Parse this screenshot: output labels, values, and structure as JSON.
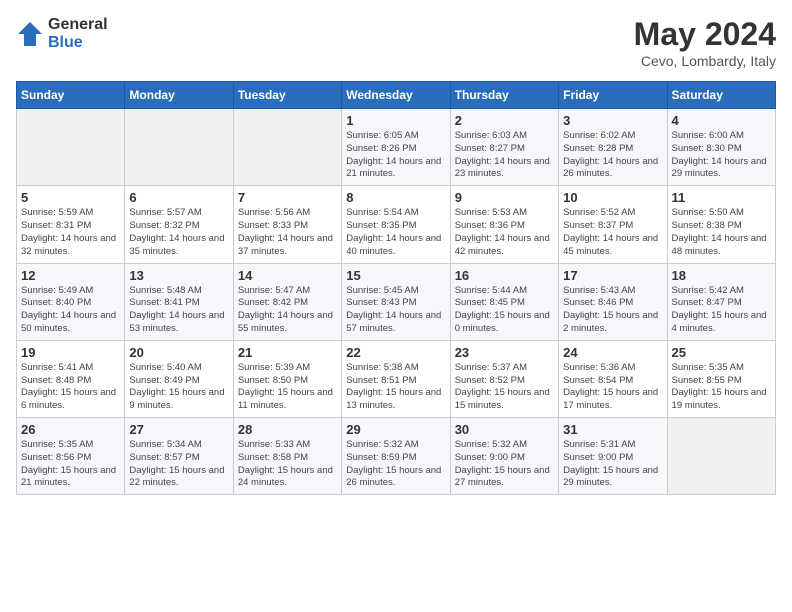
{
  "logo": {
    "general": "General",
    "blue": "Blue"
  },
  "header": {
    "title": "May 2024",
    "subtitle": "Cevo, Lombardy, Italy"
  },
  "weekdays": [
    "Sunday",
    "Monday",
    "Tuesday",
    "Wednesday",
    "Thursday",
    "Friday",
    "Saturday"
  ],
  "weeks": [
    [
      {
        "day": null
      },
      {
        "day": null
      },
      {
        "day": null
      },
      {
        "day": 1,
        "sunrise": "Sunrise: 6:05 AM",
        "sunset": "Sunset: 8:26 PM",
        "daylight": "Daylight: 14 hours and 21 minutes."
      },
      {
        "day": 2,
        "sunrise": "Sunrise: 6:03 AM",
        "sunset": "Sunset: 8:27 PM",
        "daylight": "Daylight: 14 hours and 23 minutes."
      },
      {
        "day": 3,
        "sunrise": "Sunrise: 6:02 AM",
        "sunset": "Sunset: 8:28 PM",
        "daylight": "Daylight: 14 hours and 26 minutes."
      },
      {
        "day": 4,
        "sunrise": "Sunrise: 6:00 AM",
        "sunset": "Sunset: 8:30 PM",
        "daylight": "Daylight: 14 hours and 29 minutes."
      }
    ],
    [
      {
        "day": 5,
        "sunrise": "Sunrise: 5:59 AM",
        "sunset": "Sunset: 8:31 PM",
        "daylight": "Daylight: 14 hours and 32 minutes."
      },
      {
        "day": 6,
        "sunrise": "Sunrise: 5:57 AM",
        "sunset": "Sunset: 8:32 PM",
        "daylight": "Daylight: 14 hours and 35 minutes."
      },
      {
        "day": 7,
        "sunrise": "Sunrise: 5:56 AM",
        "sunset": "Sunset: 8:33 PM",
        "daylight": "Daylight: 14 hours and 37 minutes."
      },
      {
        "day": 8,
        "sunrise": "Sunrise: 5:54 AM",
        "sunset": "Sunset: 8:35 PM",
        "daylight": "Daylight: 14 hours and 40 minutes."
      },
      {
        "day": 9,
        "sunrise": "Sunrise: 5:53 AM",
        "sunset": "Sunset: 8:36 PM",
        "daylight": "Daylight: 14 hours and 42 minutes."
      },
      {
        "day": 10,
        "sunrise": "Sunrise: 5:52 AM",
        "sunset": "Sunset: 8:37 PM",
        "daylight": "Daylight: 14 hours and 45 minutes."
      },
      {
        "day": 11,
        "sunrise": "Sunrise: 5:50 AM",
        "sunset": "Sunset: 8:38 PM",
        "daylight": "Daylight: 14 hours and 48 minutes."
      }
    ],
    [
      {
        "day": 12,
        "sunrise": "Sunrise: 5:49 AM",
        "sunset": "Sunset: 8:40 PM",
        "daylight": "Daylight: 14 hours and 50 minutes."
      },
      {
        "day": 13,
        "sunrise": "Sunrise: 5:48 AM",
        "sunset": "Sunset: 8:41 PM",
        "daylight": "Daylight: 14 hours and 53 minutes."
      },
      {
        "day": 14,
        "sunrise": "Sunrise: 5:47 AM",
        "sunset": "Sunset: 8:42 PM",
        "daylight": "Daylight: 14 hours and 55 minutes."
      },
      {
        "day": 15,
        "sunrise": "Sunrise: 5:45 AM",
        "sunset": "Sunset: 8:43 PM",
        "daylight": "Daylight: 14 hours and 57 minutes."
      },
      {
        "day": 16,
        "sunrise": "Sunrise: 5:44 AM",
        "sunset": "Sunset: 8:45 PM",
        "daylight": "Daylight: 15 hours and 0 minutes."
      },
      {
        "day": 17,
        "sunrise": "Sunrise: 5:43 AM",
        "sunset": "Sunset: 8:46 PM",
        "daylight": "Daylight: 15 hours and 2 minutes."
      },
      {
        "day": 18,
        "sunrise": "Sunrise: 5:42 AM",
        "sunset": "Sunset: 8:47 PM",
        "daylight": "Daylight: 15 hours and 4 minutes."
      }
    ],
    [
      {
        "day": 19,
        "sunrise": "Sunrise: 5:41 AM",
        "sunset": "Sunset: 8:48 PM",
        "daylight": "Daylight: 15 hours and 6 minutes."
      },
      {
        "day": 20,
        "sunrise": "Sunrise: 5:40 AM",
        "sunset": "Sunset: 8:49 PM",
        "daylight": "Daylight: 15 hours and 9 minutes."
      },
      {
        "day": 21,
        "sunrise": "Sunrise: 5:39 AM",
        "sunset": "Sunset: 8:50 PM",
        "daylight": "Daylight: 15 hours and 11 minutes."
      },
      {
        "day": 22,
        "sunrise": "Sunrise: 5:38 AM",
        "sunset": "Sunset: 8:51 PM",
        "daylight": "Daylight: 15 hours and 13 minutes."
      },
      {
        "day": 23,
        "sunrise": "Sunrise: 5:37 AM",
        "sunset": "Sunset: 8:52 PM",
        "daylight": "Daylight: 15 hours and 15 minutes."
      },
      {
        "day": 24,
        "sunrise": "Sunrise: 5:36 AM",
        "sunset": "Sunset: 8:54 PM",
        "daylight": "Daylight: 15 hours and 17 minutes."
      },
      {
        "day": 25,
        "sunrise": "Sunrise: 5:35 AM",
        "sunset": "Sunset: 8:55 PM",
        "daylight": "Daylight: 15 hours and 19 minutes."
      }
    ],
    [
      {
        "day": 26,
        "sunrise": "Sunrise: 5:35 AM",
        "sunset": "Sunset: 8:56 PM",
        "daylight": "Daylight: 15 hours and 21 minutes."
      },
      {
        "day": 27,
        "sunrise": "Sunrise: 5:34 AM",
        "sunset": "Sunset: 8:57 PM",
        "daylight": "Daylight: 15 hours and 22 minutes."
      },
      {
        "day": 28,
        "sunrise": "Sunrise: 5:33 AM",
        "sunset": "Sunset: 8:58 PM",
        "daylight": "Daylight: 15 hours and 24 minutes."
      },
      {
        "day": 29,
        "sunrise": "Sunrise: 5:32 AM",
        "sunset": "Sunset: 8:59 PM",
        "daylight": "Daylight: 15 hours and 26 minutes."
      },
      {
        "day": 30,
        "sunrise": "Sunrise: 5:32 AM",
        "sunset": "Sunset: 9:00 PM",
        "daylight": "Daylight: 15 hours and 27 minutes."
      },
      {
        "day": 31,
        "sunrise": "Sunrise: 5:31 AM",
        "sunset": "Sunset: 9:00 PM",
        "daylight": "Daylight: 15 hours and 29 minutes."
      },
      {
        "day": null
      }
    ]
  ]
}
